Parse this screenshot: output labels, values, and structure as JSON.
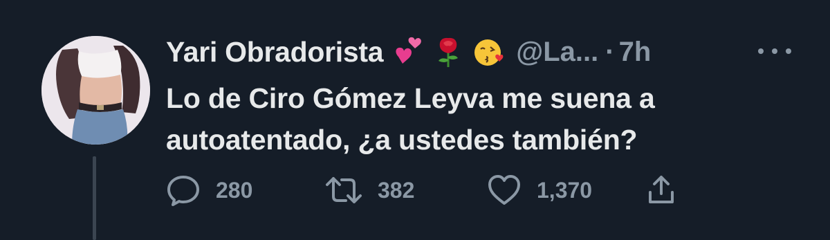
{
  "tweet": {
    "display_name": "Yari Obradorista",
    "handle": "@La...",
    "separator": "·",
    "time": "7h",
    "body_line_1": "Lo de Ciro Gómez Leyva me suena a",
    "body_line_2": "autoatentado, ¿a ustedes también?",
    "name_emojis": [
      "two-hearts-icon",
      "rose-icon",
      "face-blowing-kiss-icon"
    ]
  },
  "actions": {
    "reply_count": "280",
    "retweet_count": "382",
    "like_count": "1,370"
  },
  "colors": {
    "background": "#151d28",
    "text_primary": "#e7e9ea",
    "text_secondary": "#8b98a5"
  }
}
